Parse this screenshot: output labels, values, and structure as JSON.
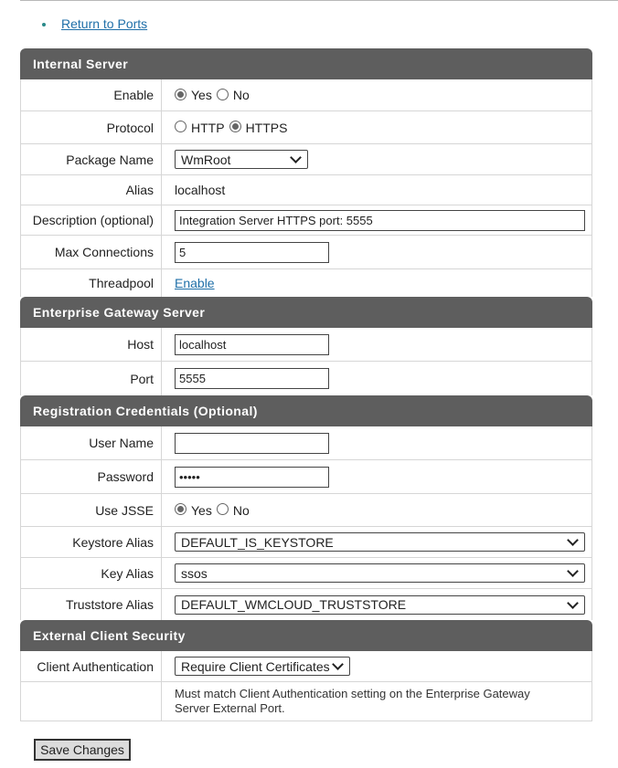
{
  "breadcrumb": {
    "return_label": "Return to Ports"
  },
  "internal_server": {
    "title": "Internal Server",
    "enable": {
      "label": "Enable",
      "yes": "Yes",
      "no": "No",
      "selected": "Yes"
    },
    "protocol": {
      "label": "Protocol",
      "http": "HTTP",
      "https": "HTTPS",
      "selected": "HTTPS"
    },
    "package_name": {
      "label": "Package Name",
      "value": "WmRoot"
    },
    "alias": {
      "label": "Alias",
      "value": "localhost"
    },
    "description": {
      "label": "Description (optional)",
      "value": "Integration Server HTTPS port: 5555"
    },
    "max_connections": {
      "label": "Max Connections",
      "value": "5"
    },
    "threadpool": {
      "label": "Threadpool",
      "link": "Enable"
    }
  },
  "gateway": {
    "title": "Enterprise Gateway Server",
    "host": {
      "label": "Host",
      "value": "localhost"
    },
    "port": {
      "label": "Port",
      "value": "5555"
    }
  },
  "credentials": {
    "title": "Registration Credentials (Optional)",
    "user_name": {
      "label": "User Name",
      "value": ""
    },
    "password": {
      "label": "Password",
      "value": "•••••"
    },
    "use_jsse": {
      "label": "Use JSSE",
      "yes": "Yes",
      "no": "No",
      "selected": "Yes"
    },
    "keystore_alias": {
      "label": "Keystore Alias",
      "value": "DEFAULT_IS_KEYSTORE"
    },
    "key_alias": {
      "label": "Key Alias",
      "value": "ssos"
    },
    "truststore_alias": {
      "label": "Truststore Alias",
      "value": "DEFAULT_WMCLOUD_TRUSTSTORE"
    }
  },
  "external": {
    "title": "External Client Security",
    "client_auth": {
      "label": "Client Authentication",
      "value": "Require Client Certificates"
    },
    "note": "Must match Client Authentication setting on the Enterprise Gateway Server External Port."
  },
  "save_label": "Save Changes",
  "colors": {
    "header_bg": "#5e5e5e",
    "link": "#1f6fa8",
    "border": "#d6d6d6"
  }
}
